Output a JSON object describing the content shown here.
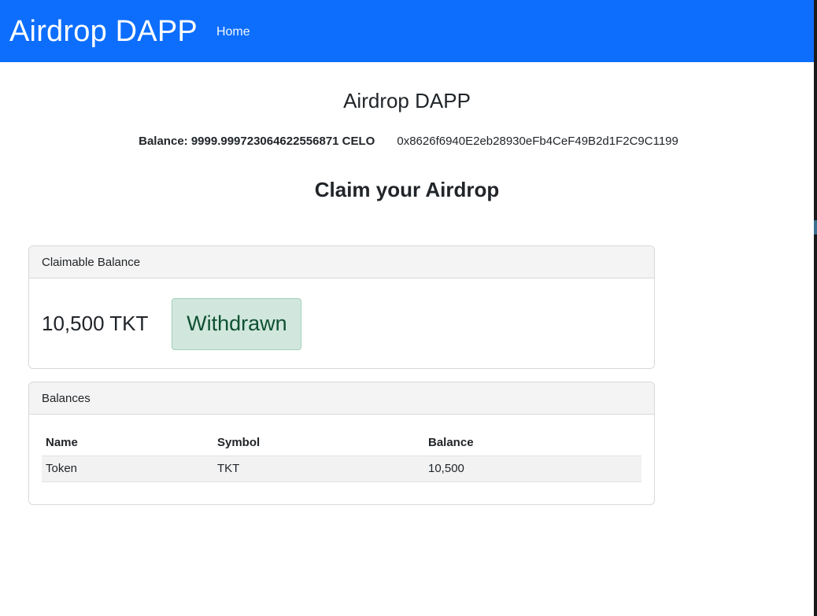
{
  "navbar": {
    "brand": "Airdrop DAPP",
    "links": [
      {
        "label": "Home"
      }
    ]
  },
  "main": {
    "title": "Airdrop DAPP",
    "balance_label": "Balance: 9999.99972306462255687​1 CELO",
    "address": "0x8626f6940E2eb28930eFb4CeF49B2d1F2C9C1199",
    "subtitle": "Claim your Airdrop"
  },
  "claim_card": {
    "header": "Claimable Balance",
    "amount": "10,500 TKT",
    "status_button": "Withdrawn"
  },
  "balances_card": {
    "header": "Balances",
    "columns": [
      "Name",
      "Symbol",
      "Balance"
    ],
    "rows": [
      {
        "name": "Token",
        "symbol": "TKT",
        "balance": "10,500"
      }
    ]
  },
  "colors": {
    "navbar": "#0d6efd",
    "success_bg": "#d1e7dd",
    "success_text": "#0f5132"
  }
}
